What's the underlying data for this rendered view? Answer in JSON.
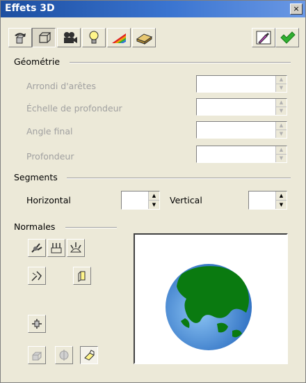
{
  "window": {
    "title": "Effets 3D",
    "close_glyph": "×"
  },
  "toolbar": {
    "buttons": [
      {
        "icon": "convert-to-3d-icon"
      },
      {
        "icon": "geometry-icon",
        "pressed": true
      },
      {
        "icon": "camera-icon"
      },
      {
        "icon": "lightbulb-icon"
      },
      {
        "icon": "texture-icon"
      },
      {
        "icon": "material-icon"
      }
    ],
    "assign_icon": "eyedropper-icon",
    "apply_icon": "checkmark-icon"
  },
  "geometry": {
    "label": "Géométrie",
    "fields": [
      {
        "label": "Arrondi d'arêtes",
        "value": ""
      },
      {
        "label": "Échelle de profondeur",
        "value": ""
      },
      {
        "label": "Angle final",
        "value": ""
      },
      {
        "label": "Profondeur",
        "value": ""
      }
    ]
  },
  "segments": {
    "label": "Segments",
    "horizontal_label": "Horizontal",
    "horizontal_value": "",
    "vertical_label": "Vertical",
    "vertical_value": ""
  },
  "normals": {
    "label": "Normales",
    "buttons": [
      {
        "icon": "object-specific-normals-icon"
      },
      {
        "icon": "flat-normals-icon"
      },
      {
        "icon": "spherical-normals-icon"
      },
      {
        "icon": "invert-normals-icon"
      },
      {
        "icon": "double-sided-lighting-icon"
      },
      {
        "icon": "double-sided-icon"
      },
      {
        "icon": "convert-to-3d-small-icon"
      },
      {
        "icon": "convert-to-lathe-icon"
      },
      {
        "icon": "perspective-on-off-icon",
        "pressed": true
      }
    ]
  },
  "preview": {
    "icon": "globe-preview-icon"
  },
  "colors": {
    "titlebar": "#2a5fb8",
    "globe_ocean": "#5aa2e8",
    "globe_land": "#0a7a10",
    "disabled_text": "#a0a0a0"
  }
}
